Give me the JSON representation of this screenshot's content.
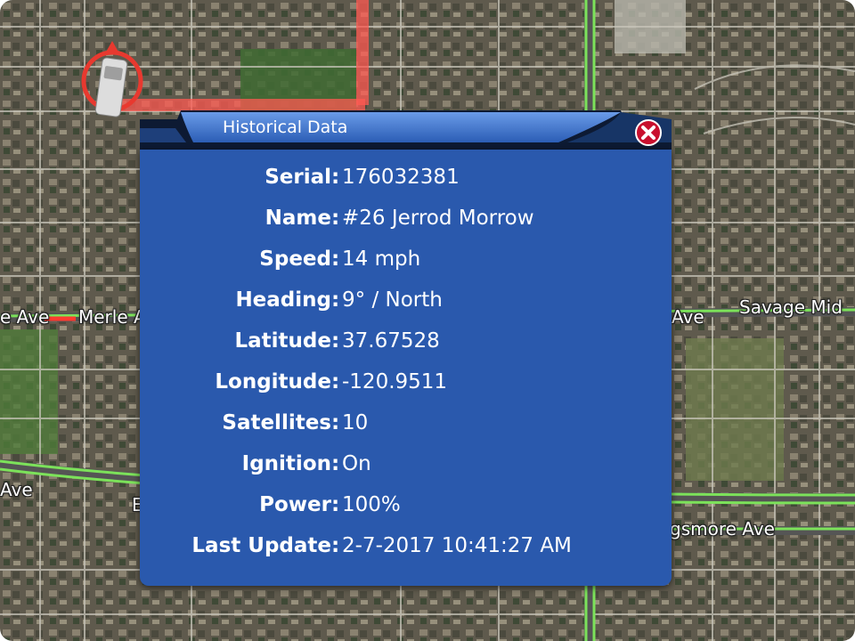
{
  "dialog": {
    "title": "Historical Data",
    "rows": [
      {
        "label": "Serial",
        "value": "176032381"
      },
      {
        "label": "Name",
        "value": "#26 Jerrod Morrow"
      },
      {
        "label": "Speed",
        "value": "14 mph"
      },
      {
        "label": "Heading",
        "value": "9° / North"
      },
      {
        "label": "Latitude",
        "value": "37.67528"
      },
      {
        "label": "Longitude",
        "value": "-120.9511"
      },
      {
        "label": "Satellites",
        "value": "10"
      },
      {
        "label": "Ignition",
        "value": "On"
      },
      {
        "label": "Power",
        "value": "100%"
      },
      {
        "label": "Last Update",
        "value": "2-7-2017 10:41:27 AM"
      }
    ]
  },
  "map": {
    "labels": {
      "merle_left": "e Ave",
      "merle_right": "Merle A",
      "savage_ave": "Ave",
      "savage_mid": "Savage Mid",
      "left_ave": "Ave",
      "left_b": "E",
      "kingsmore": "gsmore Ave"
    }
  },
  "colors": {
    "dialog_body": "#2a59ad",
    "header_dark": "#0d1a33",
    "header_light": "#4a7fd4",
    "close_red": "#c8102e",
    "route_red": "#ff5a52",
    "road_green": "#7ce25a",
    "vehicle_marker": "#e8392f"
  }
}
